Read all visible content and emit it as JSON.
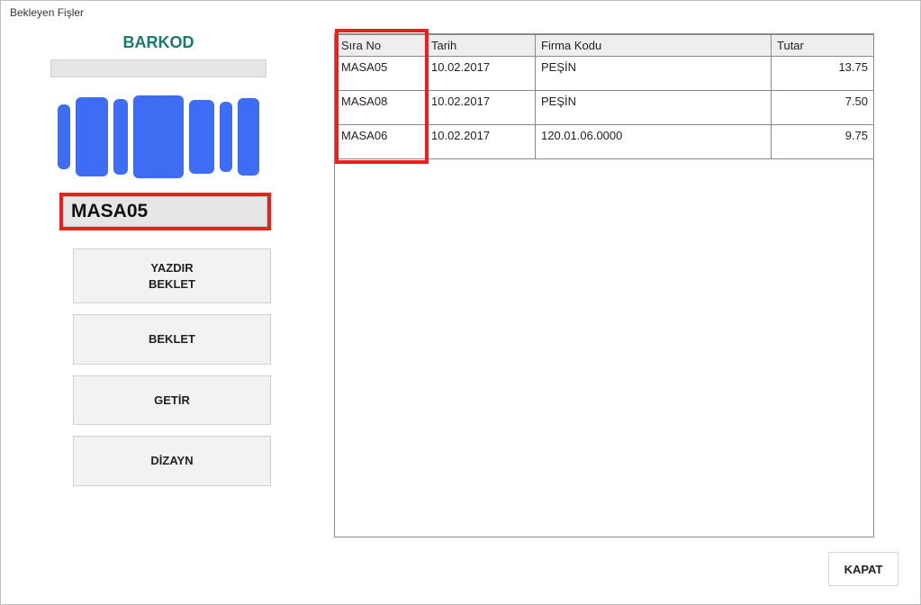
{
  "window": {
    "title": "Bekleyen Fişler"
  },
  "left": {
    "barkod_title": "BARKOD",
    "masa_value": "MASA05",
    "buttons": {
      "yazdir_line1": "YAZDIR",
      "yazdir_line2": "BEKLET",
      "beklet": "BEKLET",
      "getir": "GETİR",
      "dizayn": "DİZAYN"
    }
  },
  "grid": {
    "headers": {
      "sira": "Sıra No",
      "tarih": "Tarih",
      "firma": "Firma Kodu",
      "tutar": "Tutar"
    },
    "rows": [
      {
        "sira": "MASA05",
        "tarih": "10.02.2017",
        "firma": "PEŞİN",
        "tutar": "13.75"
      },
      {
        "sira": "MASA08",
        "tarih": "10.02.2017",
        "firma": "PEŞİN",
        "tutar": "7.50"
      },
      {
        "sira": "MASA06",
        "tarih": "10.02.2017",
        "firma": "120.01.06.0000",
        "tutar": "9.75"
      }
    ]
  },
  "footer": {
    "close": "KAPAT"
  }
}
